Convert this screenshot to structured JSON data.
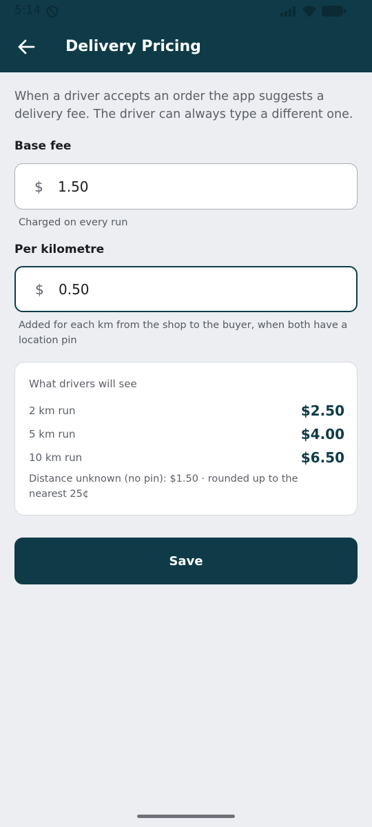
{
  "status_bar": {
    "time": "5:14"
  },
  "header": {
    "title": "Delivery Pricing"
  },
  "intro": "When a driver accepts an order the app suggests a delivery fee. The driver can always type a different one.",
  "base_fee": {
    "label": "Base fee",
    "currency": "$",
    "value": "1.50",
    "helper": "Charged on every run"
  },
  "per_km": {
    "label": "Per kilometre",
    "currency": "$",
    "value": "0.50",
    "helper": "Added for each km from the shop to the buyer, when both have a location pin"
  },
  "preview": {
    "title": "What drivers will see",
    "rows": [
      {
        "label": "2 km run",
        "price": "$2.50"
      },
      {
        "label": "5 km run",
        "price": "$4.00"
      },
      {
        "label": "10 km run",
        "price": "$6.50"
      }
    ],
    "note": "Distance unknown (no pin): $1.50 · rounded up to the nearest 25¢"
  },
  "save_label": "Save",
  "colors": {
    "primary": "#0e3b47",
    "background": "#eceef2",
    "card": "#ffffff"
  }
}
